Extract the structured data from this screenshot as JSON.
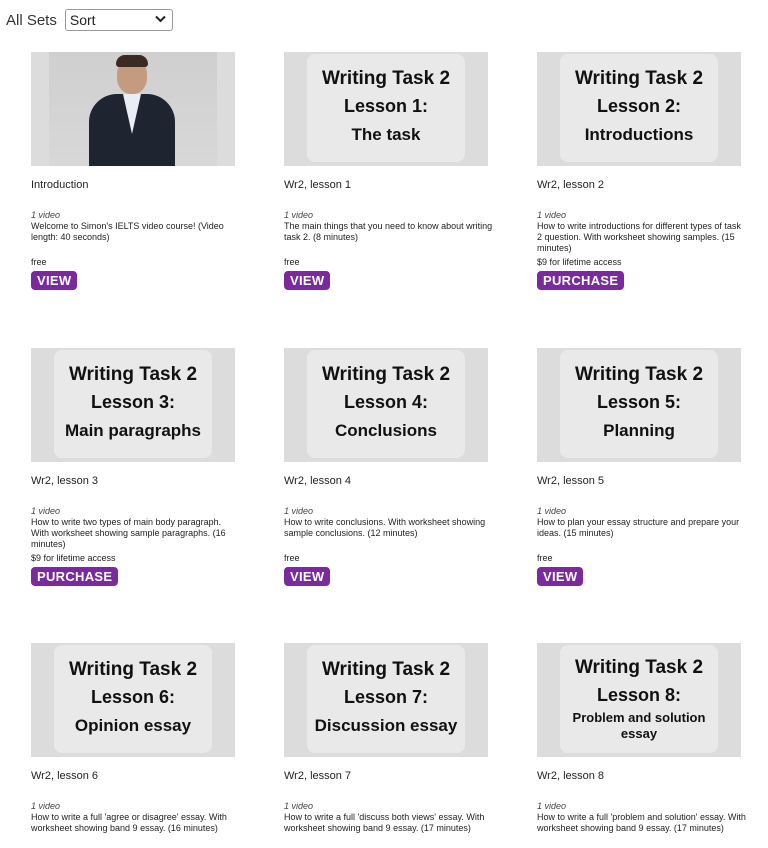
{
  "header": {
    "all_sets": "All Sets",
    "sort_value": "Sort",
    "sort_icon": "chevron-down-icon"
  },
  "cards": [
    {
      "thumb_lines": [],
      "title": "Introduction",
      "count": "1 video",
      "desc": "Welcome to Simon's IELTS video course! (Video length: 40 seconds)",
      "price": "free",
      "button": "VIEW"
    },
    {
      "thumb_lines": [
        "Writing Task 2",
        "Lesson 1:",
        "The task"
      ],
      "title": "Wr2, lesson 1",
      "count": "1 video",
      "desc": "The main things that you need to know about writing task 2. (8 minutes)",
      "price": "free",
      "button": "VIEW"
    },
    {
      "thumb_lines": [
        "Writing Task 2",
        "Lesson 2:",
        "Introductions"
      ],
      "title": "Wr2, lesson 2",
      "count": "1 video",
      "desc": "How to write introductions for different types of task 2 question. With worksheet showing samples. (15 minutes)",
      "price": "$9 for lifetime access",
      "button": "PURCHASE"
    },
    {
      "thumb_lines": [
        "Writing Task 2",
        "Lesson 3:",
        "Main paragraphs"
      ],
      "title": "Wr2, lesson 3",
      "count": "1 video",
      "desc": "How to write two types of main body paragraph. With worksheet showing sample paragraphs. (16 minutes)",
      "price": "$9 for lifetime access",
      "button": "PURCHASE"
    },
    {
      "thumb_lines": [
        "Writing Task 2",
        "Lesson 4:",
        "Conclusions"
      ],
      "title": "Wr2, lesson 4",
      "count": "1 video",
      "desc": "How to write conclusions. With worksheet showing sample conclusions. (12 minutes)",
      "price": "free",
      "button": "VIEW"
    },
    {
      "thumb_lines": [
        "Writing Task 2",
        "Lesson 5:",
        "Planning"
      ],
      "title": "Wr2, lesson 5",
      "count": "1 video",
      "desc": "How to plan your essay structure and prepare your ideas. (15 minutes)",
      "price": "free",
      "button": "VIEW"
    },
    {
      "thumb_lines": [
        "Writing Task 2",
        "Lesson 6:",
        "Opinion essay"
      ],
      "title": "Wr2, lesson 6",
      "count": "1 video",
      "desc": "How to write a full 'agree or disagree' essay. With worksheet showing band 9 essay. (16 minutes)",
      "price": "",
      "button": ""
    },
    {
      "thumb_lines": [
        "Writing Task 2",
        "Lesson 7:",
        "Discussion essay"
      ],
      "title": "Wr2, lesson 7",
      "count": "1 video",
      "desc": "How to write a full 'discuss both views' essay. With worksheet showing band 9 essay. (17 minutes)",
      "price": "",
      "button": ""
    },
    {
      "thumb_lines": [
        "Writing Task 2",
        "Lesson 8:",
        "Problem and solution essay"
      ],
      "title": "Wr2, lesson 8",
      "count": "1 video",
      "desc": "How to write a full 'problem and solution' essay. With worksheet showing band 9 essay. (17 minutes)",
      "price": "",
      "button": ""
    }
  ],
  "colors": {
    "button_bg": "#7a2a9c",
    "thumb_bg": "#dcdcdc",
    "panel_bg": "#e9e9e9"
  }
}
